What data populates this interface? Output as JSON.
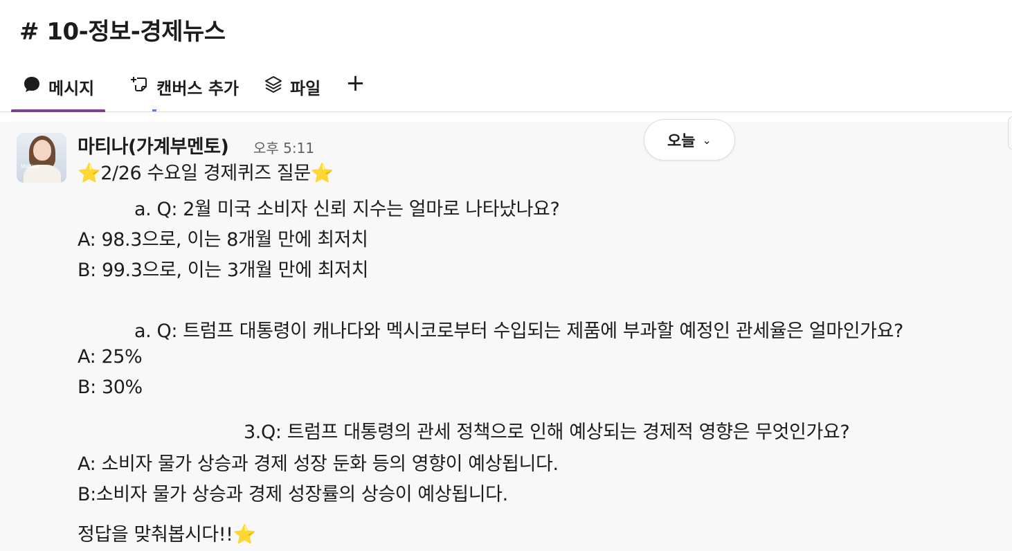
{
  "channel": {
    "title": "# 10-정보-경제뉴스"
  },
  "tabs": [
    {
      "label": "메시지",
      "icon": "message-bubble-icon",
      "active": true
    },
    {
      "label": "캔버스 추가",
      "icon": "canvas-add-icon",
      "active": false
    },
    {
      "label": "파일",
      "icon": "layers-icon",
      "active": false
    },
    {
      "label": "+",
      "icon": "plus-icon",
      "active": false
    }
  ],
  "date_pill": {
    "label": "오늘",
    "icon": "chevron-down-icon"
  },
  "accent_color": "#7c3f93",
  "message": {
    "sender": "마티나(가계부멘토)",
    "time": "오후 5:11",
    "avatar_brand": "Mattina",
    "lines": {
      "title": "⭐2/26 수요일 경제퀴즈 질문⭐",
      "q1": "a.   Q: 2월 미국 소비자 신뢰 지수는 얼마로 나타났나요?",
      "q1_a": "A: 98.3으로, 이는 8개월 만에 최저치",
      "q1_b": "B: 99.3으로, 이는 3개월 만에 최저치",
      "q2": "a.   Q: 트럼프 대통령이 캐나다와 멕시코로부터 수입되는 제품에 부과할 예정인 관세율은 얼마인가요?",
      "q2_a": "A: 25%",
      "q2_b": "B: 30%",
      "q3": "3.Q: 트럼프 대통령의 관세 정책으로 인해 예상되는 경제적 영향은 무엇인가요?",
      "q3_a": "A: 소비자 물가 상승과 경제 성장 둔화 등의 영향이 예상됩니다.",
      "q3_b": "B:소비자 물가 상승과 경제 성장률의 상승이 예상됩니다.",
      "closing": "정답을 맞춰봅시다!!⭐"
    }
  }
}
